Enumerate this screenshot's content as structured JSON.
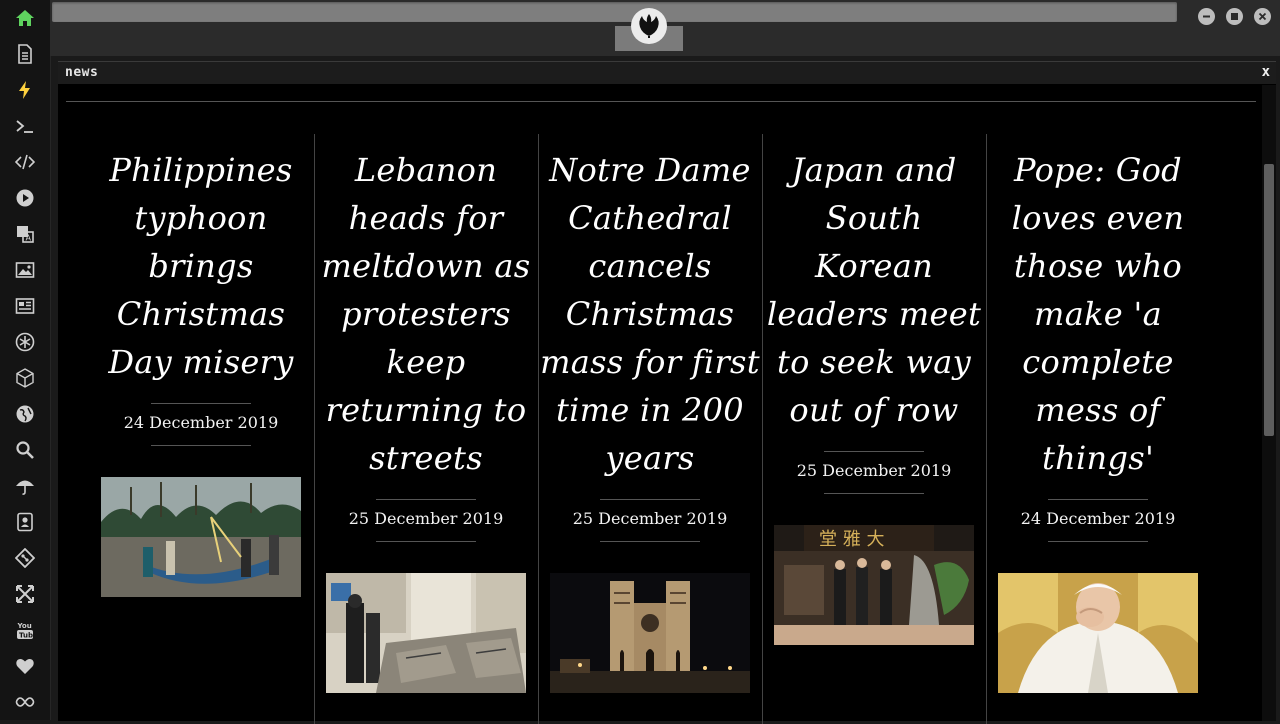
{
  "sidebar": {
    "icons": [
      "home-icon",
      "document-icon",
      "bolt-icon",
      "terminal-icon",
      "code-icon",
      "play-icon",
      "translate-icon",
      "image-icon",
      "newspaper-icon",
      "asterisk-icon",
      "cube-icon",
      "globe-icon",
      "search-icon",
      "umbrella-icon",
      "contact-icon",
      "git-icon",
      "expand-icon",
      "youtube-icon",
      "heart-icon",
      "infinity-icon"
    ],
    "accent": "#5fd35f"
  },
  "window": {
    "title": "news",
    "close_label": "x"
  },
  "articles": [
    {
      "headline": "Philippines typhoon brings Christmas Day misery",
      "date": "24 December 2019",
      "image": "boat-on-beach-image"
    },
    {
      "headline": "Lebanon heads for meltdown as protesters keep returning to streets",
      "date": "25 December 2019",
      "image": "protest-rubble-image"
    },
    {
      "headline": "Notre Dame Cathedral cancels Christmas mass for first time in 200 years",
      "date": "25 December 2019",
      "image": "cathedral-night-image"
    },
    {
      "headline": "Japan and South Korean leaders meet to seek way out of row",
      "date": "25 December 2019",
      "image": "leaders-meeting-image"
    },
    {
      "headline": "Pope: God loves even those who make 'a complete mess of things'",
      "date": "24 December 2019",
      "image": "pope-image"
    }
  ]
}
